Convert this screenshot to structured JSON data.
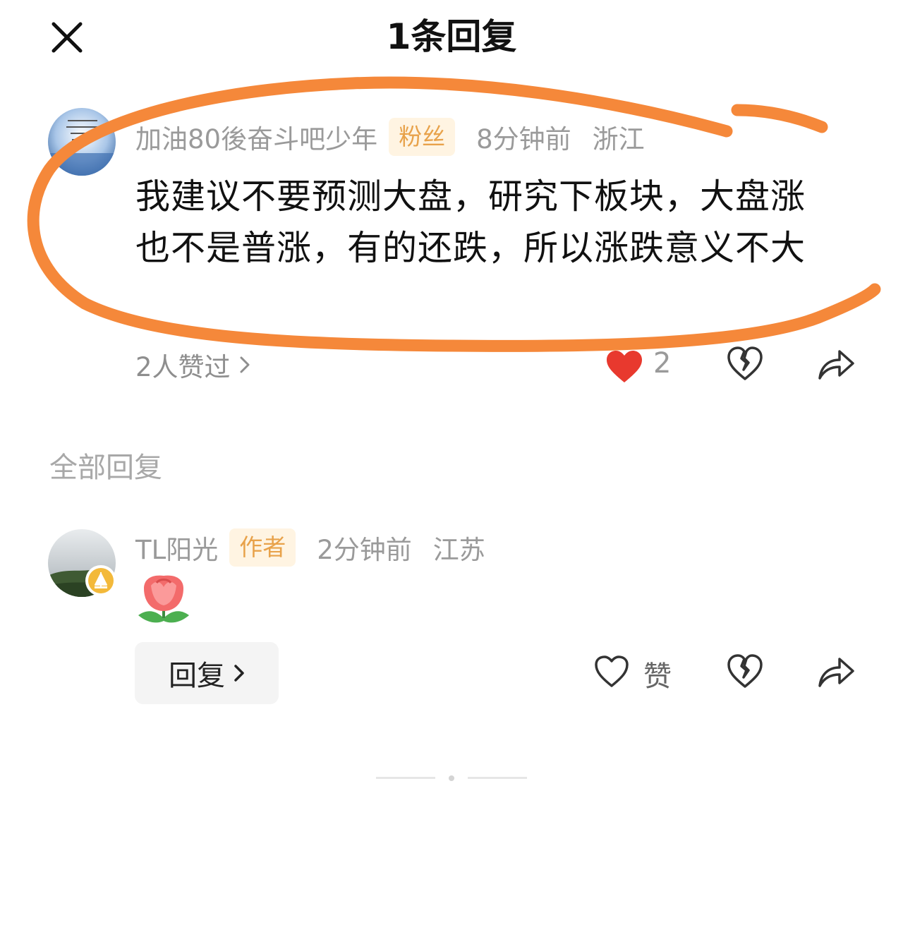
{
  "header": {
    "title": "1条回复",
    "close_icon": "close-icon"
  },
  "comment": {
    "username": "加油80後奋斗吧少年",
    "badge": "粉丝",
    "time": "8分钟前",
    "region": "浙江",
    "text": "我建议不要预测大盘，研究下板块，大盘涨也不是普涨，有的还跌，所以涨跌意义不大",
    "likers": "2人赞过",
    "like_count": "2",
    "like_icon": "heart-filled-icon",
    "dislike_icon": "broken-heart-icon",
    "share_icon": "share-icon"
  },
  "section": {
    "title": "全部回复"
  },
  "reply": {
    "username": "TL阳光",
    "badge": "作者",
    "time": "2分钟前",
    "region": "江苏",
    "emoji": "tulip-emoji",
    "reply_button": "回复",
    "like_label": "赞"
  },
  "colors": {
    "badge_bg": "#fff4e2",
    "badge_text": "#e8a24a",
    "heart_red": "#e8392e",
    "annotation_orange": "#f5883a",
    "meta_gray": "#9a9a9a"
  }
}
